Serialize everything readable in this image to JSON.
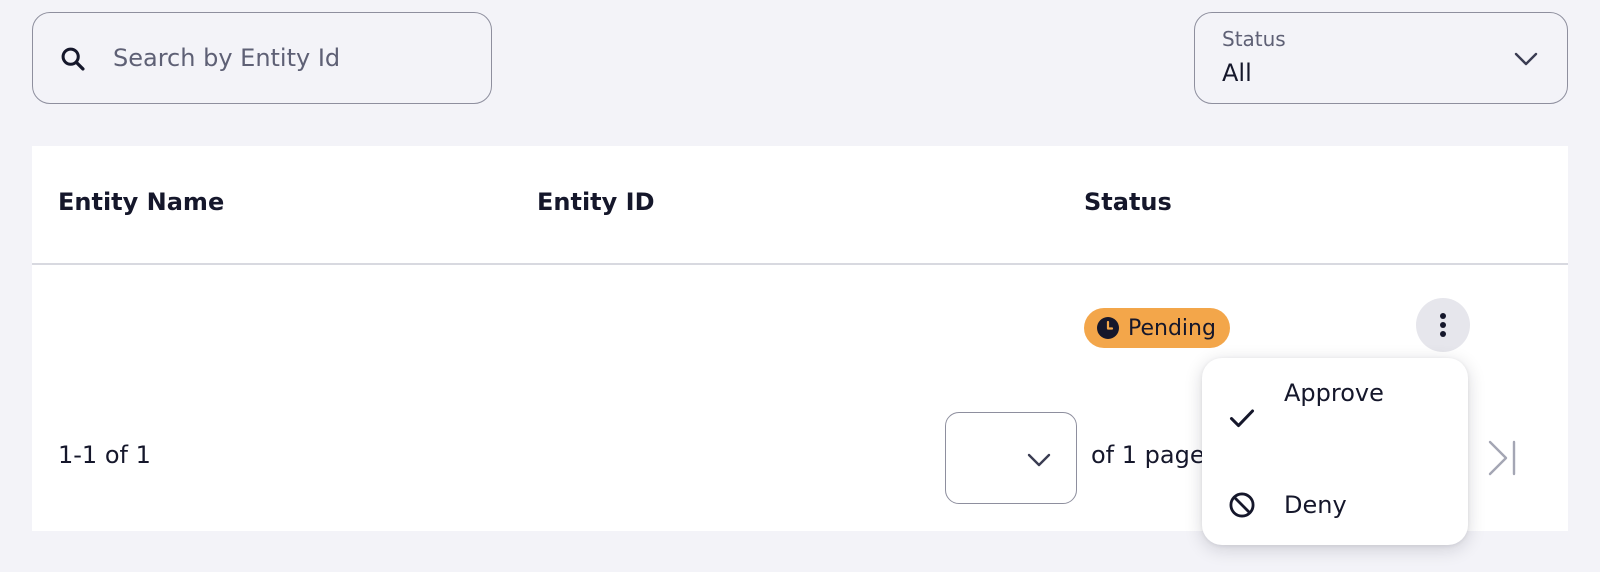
{
  "search": {
    "placeholder": "Search by Entity Id",
    "icon": "search-icon"
  },
  "status_filter": {
    "label": "Status",
    "value": "All",
    "icon": "chevron-down-icon"
  },
  "table": {
    "columns": [
      "Entity Name",
      "Entity ID",
      "Status"
    ],
    "rows": [
      {
        "entity_name": "",
        "entity_id": "",
        "status": "Pending",
        "status_icon": "clock-icon",
        "status_color": "#f3a64a"
      }
    ]
  },
  "row_actions_menu": {
    "items": [
      {
        "label": "Approve",
        "icon": "check-icon"
      },
      {
        "label": "Deny",
        "icon": "block-icon"
      }
    ]
  },
  "pagination": {
    "range_text": "1-1 of 1",
    "page_select_value": "",
    "of_pages_text": "of 1 pages",
    "last_page_icon": "last-page-icon"
  },
  "colors": {
    "background": "#f3f3f8",
    "pending_badge": "#f3a64a",
    "text": "#15172b"
  }
}
